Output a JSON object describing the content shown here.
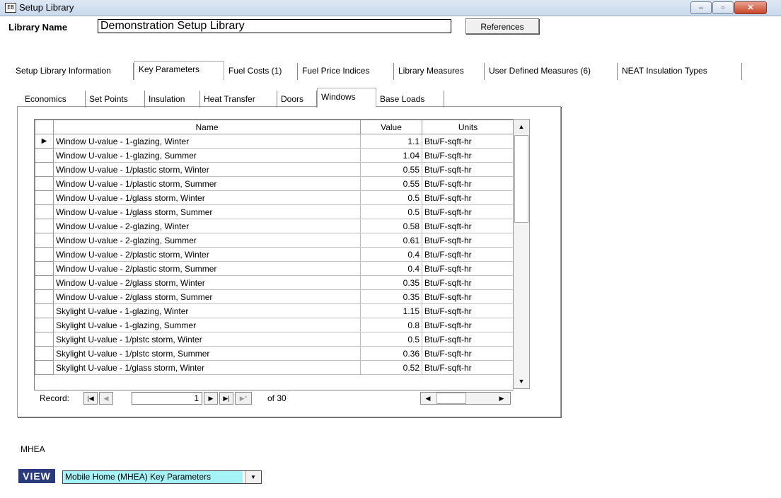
{
  "window": {
    "title": "Setup Library",
    "app_icon": "EB",
    "min_glyph": "–",
    "max_glyph": "▫",
    "close_glyph": "✕"
  },
  "library": {
    "name_label": "Library Name",
    "name_value": "Demonstration Setup Library",
    "references_label": "References"
  },
  "outer_tabs": [
    {
      "label": "Setup Library Information",
      "selected": false
    },
    {
      "label": "Key Parameters",
      "selected": true
    },
    {
      "label": "Fuel Costs (1)",
      "selected": false
    },
    {
      "label": "Fuel Price Indices",
      "selected": false
    },
    {
      "label": "Library Measures",
      "selected": false
    },
    {
      "label": "User Defined Measures (6)",
      "selected": false
    },
    {
      "label": "NEAT Insulation Types",
      "selected": false
    }
  ],
  "inner_tabs": [
    {
      "label": "Economics",
      "selected": false
    },
    {
      "label": "Set Points",
      "selected": false
    },
    {
      "label": "Insulation",
      "selected": false
    },
    {
      "label": "Heat Transfer",
      "selected": false
    },
    {
      "label": "Doors",
      "selected": false
    },
    {
      "label": "Windows",
      "selected": true
    },
    {
      "label": "Base Loads",
      "selected": false
    }
  ],
  "grid": {
    "columns": {
      "name": "Name",
      "value": "Value",
      "units": "Units"
    },
    "current_row_marker": "▶",
    "rows": [
      {
        "name": "Window U-value - 1-glazing, Winter",
        "value": "1.1",
        "units": "Btu/F-sqft-hr"
      },
      {
        "name": "Window U-value - 1-glazing, Summer",
        "value": "1.04",
        "units": "Btu/F-sqft-hr"
      },
      {
        "name": "Window U-value - 1/plastic storm, Winter",
        "value": "0.55",
        "units": "Btu/F-sqft-hr"
      },
      {
        "name": "Window U-value - 1/plastic storm, Summer",
        "value": "0.55",
        "units": "Btu/F-sqft-hr"
      },
      {
        "name": "Window U-value - 1/glass storm, Winter",
        "value": "0.5",
        "units": "Btu/F-sqft-hr"
      },
      {
        "name": "Window U-value - 1/glass storm, Summer",
        "value": "0.5",
        "units": "Btu/F-sqft-hr"
      },
      {
        "name": "Window U-value - 2-glazing, Winter",
        "value": "0.58",
        "units": "Btu/F-sqft-hr"
      },
      {
        "name": "Window U-value - 2-glazing, Summer",
        "value": "0.61",
        "units": "Btu/F-sqft-hr"
      },
      {
        "name": "Window U-value - 2/plastic storm, Winter",
        "value": "0.4",
        "units": "Btu/F-sqft-hr"
      },
      {
        "name": "Window U-value - 2/plastic storm, Summer",
        "value": "0.4",
        "units": "Btu/F-sqft-hr"
      },
      {
        "name": "Window U-value - 2/glass storm, Winter",
        "value": "0.35",
        "units": "Btu/F-sqft-hr"
      },
      {
        "name": "Window U-value - 2/glass storm, Summer",
        "value": "0.35",
        "units": "Btu/F-sqft-hr"
      },
      {
        "name": "Skylight U-value - 1-glazing, Winter",
        "value": "1.15",
        "units": "Btu/F-sqft-hr"
      },
      {
        "name": "Skylight U-value - 1-glazing, Summer",
        "value": "0.8",
        "units": "Btu/F-sqft-hr"
      },
      {
        "name": "Skylight U-value - 1/plstc storm, Winter",
        "value": "0.5",
        "units": "Btu/F-sqft-hr"
      },
      {
        "name": "Skylight U-value - 1/plstc storm, Summer",
        "value": "0.36",
        "units": "Btu/F-sqft-hr"
      },
      {
        "name": "Skylight U-value - 1/glass storm, Winter",
        "value": "0.52",
        "units": "Btu/F-sqft-hr"
      }
    ]
  },
  "navigation": {
    "record_label": "Record:",
    "current_record": "1",
    "of_text": "of 30",
    "first_glyph": "|◀",
    "prev_glyph": "◀",
    "next_glyph": "▶",
    "last_glyph": "▶|",
    "new_glyph": "▶*"
  },
  "scroll": {
    "up_glyph": "▲",
    "down_glyph": "▼",
    "left_glyph": "◀",
    "right_glyph": "▶"
  },
  "footer": {
    "section_label": "MHEA",
    "view_label": "VIEW",
    "view_selected": "Mobile Home (MHEA) Key Parameters",
    "dropdown_glyph": "▼"
  },
  "colors": {
    "view_label_bg": "#2a3a7a",
    "view_select_bg": "#a5f3f7",
    "close_button": "#c8462b"
  }
}
